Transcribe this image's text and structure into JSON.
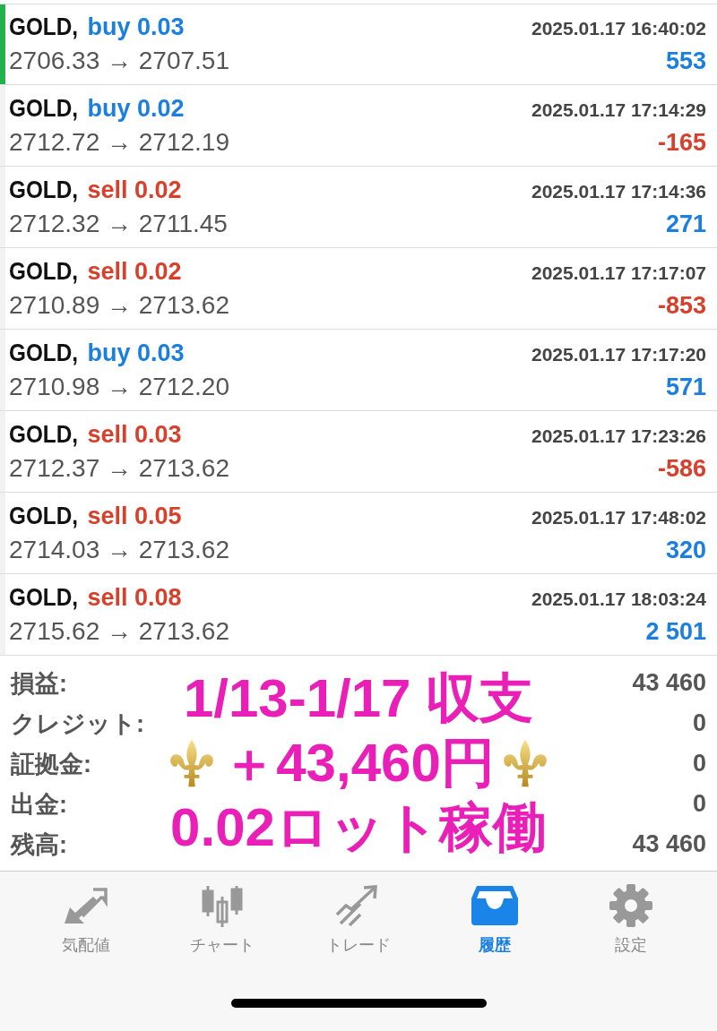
{
  "deals": [
    {
      "symbol": "GOLD,",
      "side": "buy",
      "volume": "0.03",
      "time": "2025.01.17 16:40:02",
      "prices": "2706.33 → 2707.51",
      "profit": "553",
      "loss": false,
      "selected": true
    },
    {
      "symbol": "GOLD,",
      "side": "buy",
      "volume": "0.02",
      "time": "2025.01.17 17:14:29",
      "prices": "2712.72 → 2712.19",
      "profit": "-165",
      "loss": true,
      "selected": false
    },
    {
      "symbol": "GOLD,",
      "side": "sell",
      "volume": "0.02",
      "time": "2025.01.17 17:14:36",
      "prices": "2712.32 → 2711.45",
      "profit": "271",
      "loss": false,
      "selected": false
    },
    {
      "symbol": "GOLD,",
      "side": "sell",
      "volume": "0.02",
      "time": "2025.01.17 17:17:07",
      "prices": "2710.89 → 2713.62",
      "profit": "-853",
      "loss": true,
      "selected": false
    },
    {
      "symbol": "GOLD,",
      "side": "buy",
      "volume": "0.03",
      "time": "2025.01.17 17:17:20",
      "prices": "2710.98 → 2712.20",
      "profit": "571",
      "loss": false,
      "selected": false
    },
    {
      "symbol": "GOLD,",
      "side": "sell",
      "volume": "0.03",
      "time": "2025.01.17 17:23:26",
      "prices": "2712.37 → 2713.62",
      "profit": "-586",
      "loss": true,
      "selected": false
    },
    {
      "symbol": "GOLD,",
      "side": "sell",
      "volume": "0.05",
      "time": "2025.01.17 17:48:02",
      "prices": "2714.03 → 2713.62",
      "profit": "320",
      "loss": false,
      "selected": false
    },
    {
      "symbol": "GOLD,",
      "side": "sell",
      "volume": "0.08",
      "time": "2025.01.17 18:03:24",
      "prices": "2715.62 → 2713.62",
      "profit": "2 501",
      "loss": false,
      "selected": false
    }
  ],
  "summary": [
    {
      "label": "損益:",
      "value": "43 460"
    },
    {
      "label": "クレジット:",
      "value": "0"
    },
    {
      "label": "証拠金:",
      "value": "0"
    },
    {
      "label": "出金:",
      "value": "0"
    },
    {
      "label": "残高:",
      "value": "43 460"
    }
  ],
  "overlay": {
    "lines": [
      {
        "text": "1/13-1/17 収支",
        "fleurs": false
      },
      {
        "text": "＋43,460円",
        "fleurs": true
      },
      {
        "text": "0.02ロット稼働",
        "fleurs": false
      }
    ]
  },
  "tab_bar": [
    {
      "label": "気配値",
      "selected": false
    },
    {
      "label": "チャート",
      "selected": false
    },
    {
      "label": "トレード",
      "selected": false
    },
    {
      "label": "履歴",
      "selected": true
    },
    {
      "label": "設定",
      "selected": false
    }
  ]
}
